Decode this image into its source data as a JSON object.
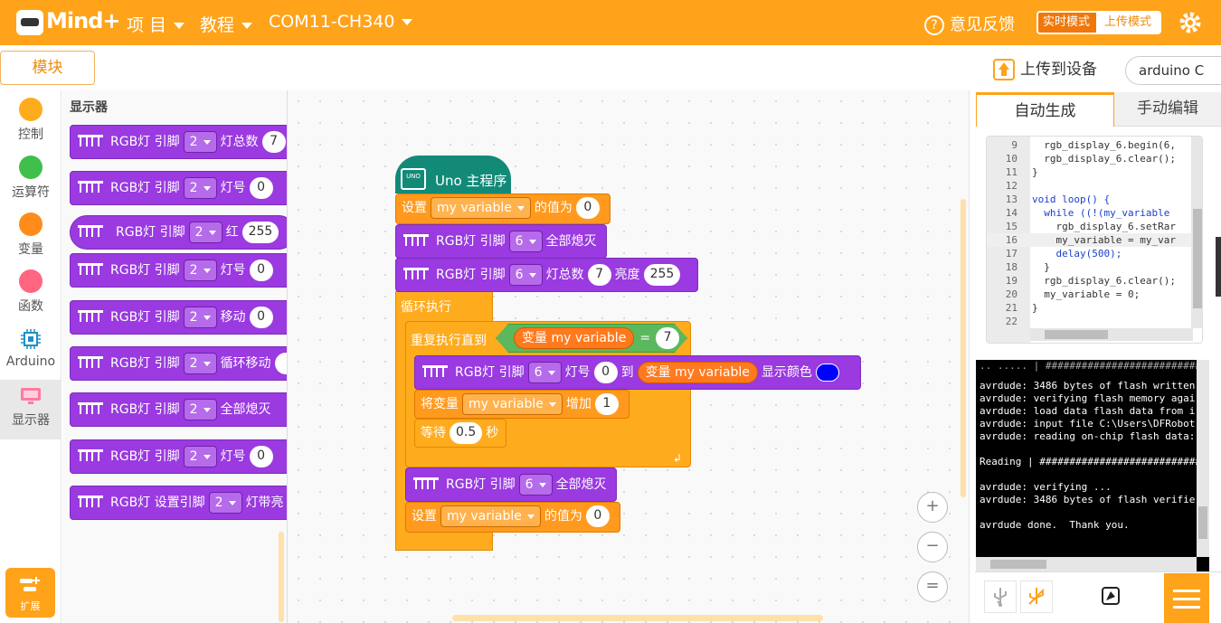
{
  "app": {
    "logo": "Mind+",
    "menus": [
      {
        "label": "项 目"
      },
      {
        "label": "教程"
      },
      {
        "label": "COM11-CH340"
      }
    ],
    "feedback": "意见反馈",
    "mode_realtime": "实时模式",
    "mode_upload": "上传模式",
    "modules_tab": "模块",
    "upload_button": "上传到设备",
    "language": "arduino C",
    "accent_color": "#ffa31a"
  },
  "categories": [
    {
      "label": "控制",
      "color": "#ffab1e"
    },
    {
      "label": "运算符",
      "color": "#40bf4a"
    },
    {
      "label": "变量",
      "color": "#ff8c1a"
    },
    {
      "label": "函数",
      "color": "#ff6680"
    },
    {
      "label": "Arduino",
      "icon": "chip-icon"
    },
    {
      "label": "显示器",
      "icon": "display-icon"
    }
  ],
  "extension_label": "扩展",
  "palette": {
    "title": "显示器",
    "blocks": [
      {
        "prefix": "RGB灯 引脚",
        "pin": "2",
        "text": "灯总数",
        "val": "7"
      },
      {
        "prefix": "RGB灯 引脚",
        "pin": "2",
        "text": "灯号",
        "val": "0"
      },
      {
        "prefix": "RGB灯 引脚",
        "pin": "2",
        "text": "红",
        "val": "255"
      },
      {
        "prefix": "RGB灯 引脚",
        "pin": "2",
        "text": "灯号",
        "val": "0"
      },
      {
        "prefix": "RGB灯 引脚",
        "pin": "2",
        "text": "移动",
        "val": "0"
      },
      {
        "prefix": "RGB灯 引脚",
        "pin": "2",
        "text": "循环移动",
        "val": ""
      },
      {
        "prefix": "RGB灯 引脚",
        "pin": "2",
        "text": "全部熄灭",
        "val": ""
      },
      {
        "prefix": "RGB灯 引脚",
        "pin": "2",
        "text": "灯号",
        "val": "0"
      },
      {
        "prefix": "RGB灯 设置引脚",
        "pin": "2",
        "text": "灯带亮",
        "val": ""
      }
    ]
  },
  "script": {
    "hat": "Uno 主程序",
    "board_label": "UNO",
    "set1": {
      "label": "设置",
      "var": "my variable",
      "suffix": "的值为",
      "val": "0"
    },
    "rgb_off": {
      "prefix": "RGB灯 引脚",
      "pin": "6",
      "text": "全部熄灭"
    },
    "rgb_init": {
      "prefix": "RGB灯 引脚",
      "pin": "6",
      "text": "灯总数",
      "count": "7",
      "bright_label": "亮度",
      "bright": "255"
    },
    "forever": "循环执行",
    "repeat_until": "重复执行直到",
    "cond_var": "变量 my variable",
    "cond_op": "=",
    "cond_val": "7",
    "rgb_range": {
      "prefix": "RGB灯 引脚",
      "pin": "6",
      "text": "灯号",
      "from": "0",
      "to_label": "到",
      "to_var": "变量 my variable",
      "color_label": "显示颜色",
      "color": "#0000ff"
    },
    "change": {
      "label": "将变量",
      "var": "my variable",
      "suffix": "增加",
      "val": "1"
    },
    "wait": {
      "label": "等待",
      "val": "0.5",
      "unit": "秒"
    },
    "rgb_off2": {
      "prefix": "RGB灯 引脚",
      "pin": "6",
      "text": "全部熄灭"
    },
    "set2": {
      "label": "设置",
      "var": "my variable",
      "suffix": "的值为",
      "val": "0"
    }
  },
  "zoom": {
    "in": "+",
    "out": "−",
    "reset": "="
  },
  "code": {
    "tab_auto": "自动生成",
    "tab_manual": "手动编辑",
    "lines": [
      {
        "n": "9",
        "t": "  rgb_display_6.begin(6,"
      },
      {
        "n": "10",
        "t": "  rgb_display_6.clear();"
      },
      {
        "n": "11",
        "t": "}"
      },
      {
        "n": "12",
        "t": ""
      },
      {
        "n": "13",
        "t": "void loop() {"
      },
      {
        "n": "14",
        "t": "  while ((!(my_variable"
      },
      {
        "n": "15",
        "t": "    rgb_display_6.setRar"
      },
      {
        "n": "16",
        "t": "    my_variable = my_var"
      },
      {
        "n": "17",
        "t": "    delay(500);"
      },
      {
        "n": "18",
        "t": "  }"
      },
      {
        "n": "19",
        "t": "  rgb_display_6.clear();"
      },
      {
        "n": "20",
        "t": "  my_variable = 0;"
      },
      {
        "n": "21",
        "t": "}"
      },
      {
        "n": "22",
        "t": ""
      }
    ]
  },
  "console": {
    "lines": [
      "avrdude: 3486 bytes of flash written",
      "avrdude: verifying flash memory agai",
      "avrdude: load data flash data from i",
      "avrdude: input file C:\\Users\\DFRobot",
      "avrdude: reading on-chip flash data:",
      "",
      "Reading | ###########################",
      "",
      "avrdude: verifying ...",
      "avrdude: 3486 bytes of flash verifie",
      "",
      "avrdude done.  Thank you."
    ]
  }
}
